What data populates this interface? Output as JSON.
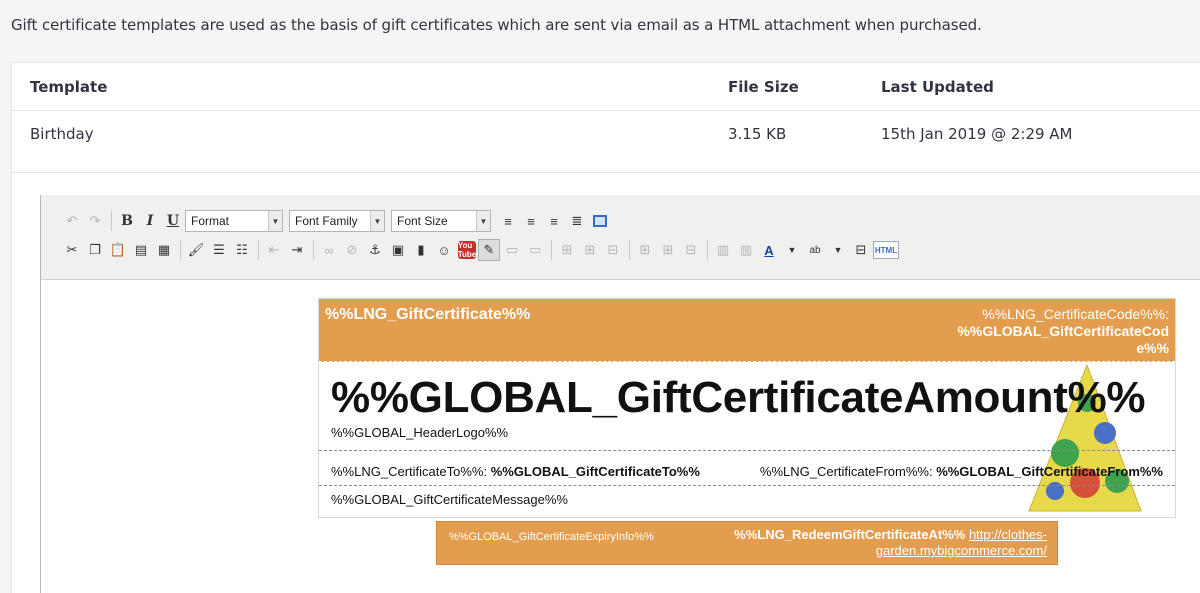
{
  "intro_text": "Gift certificate templates are used as the basis of gift certificates which are sent via email as a HTML attachment when purchased.",
  "table": {
    "headers": {
      "template": "Template",
      "file_size": "File Size",
      "last_updated": "Last Updated"
    },
    "row": {
      "template": "Birthday",
      "file_size": "3.15 KB",
      "last_updated": "15th Jan 2019 @ 2:29 AM"
    }
  },
  "toolbar": {
    "format": "Format",
    "font_family": "Font Family",
    "font_size": "Font Size",
    "bold": "B",
    "italic": "I",
    "underline": "U",
    "youtube": "You Tube",
    "html": "HTML"
  },
  "certificate": {
    "title": "%%LNG_GiftCertificate%%",
    "code_label": "%%LNG_CertificateCode%%:",
    "code_value": "%%GLOBAL_GiftCertificateCode%%",
    "amount": "%%GLOBAL_GiftCertificateAmount%%",
    "header_logo": "%%GLOBAL_HeaderLogo%%",
    "to_label": "%%LNG_CertificateTo%%:",
    "to_value": "%%GLOBAL_GiftCertificateTo%%",
    "from_label": "%%LNG_CertificateFrom%%:",
    "from_value": "%%GLOBAL_GiftCertificateFrom%%",
    "message": "%%GLOBAL_GiftCertificateMessage%%",
    "expiry": "%%GLOBAL_GiftCertificateExpiryInfo%%",
    "redeem_label": "%%LNG_RedeemGiftCertificateAt%%",
    "redeem_url": "http://clothes-garden.mybigcommerce.com/",
    "accent_color": "#e39d4e"
  }
}
